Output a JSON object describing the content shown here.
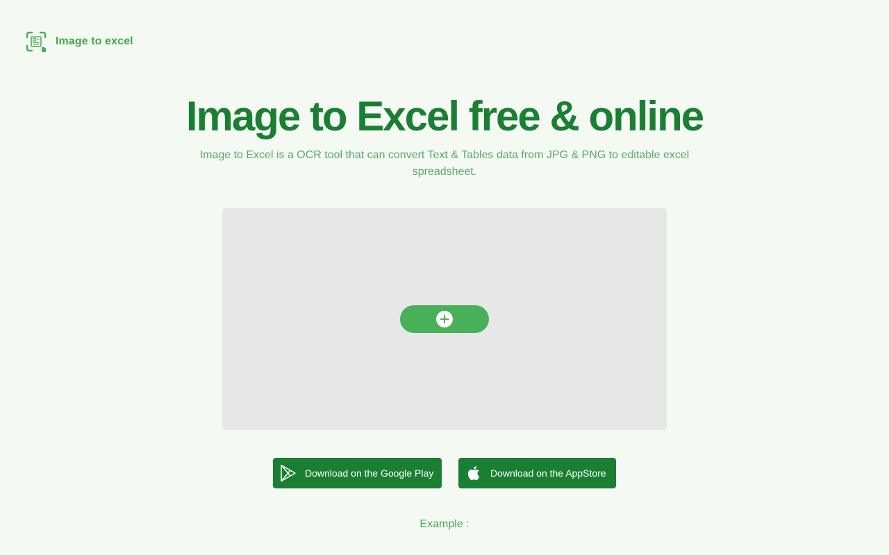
{
  "header": {
    "logo_text": "Image to excel",
    "logo_icon": "document-scan-icon"
  },
  "hero": {
    "title": "Image to Excel free & online",
    "subtitle": "Image to Excel is a OCR tool that can convert Text & Tables data from JPG & PNG to editable excel spreadsheet."
  },
  "upload": {
    "button_icon": "plus-icon"
  },
  "stores": {
    "google_label": "Download on the Google Play",
    "google_icon": "google-play-icon",
    "apple_label": "Download on the AppStore",
    "apple_icon": "apple-icon"
  },
  "example": {
    "label": "Example :"
  },
  "colors": {
    "background": "#f4f9f3",
    "primary_dark": "#1a7f33",
    "primary": "#48b058",
    "text_green": "#43a84c",
    "upload_bg": "#e8e7e8"
  }
}
